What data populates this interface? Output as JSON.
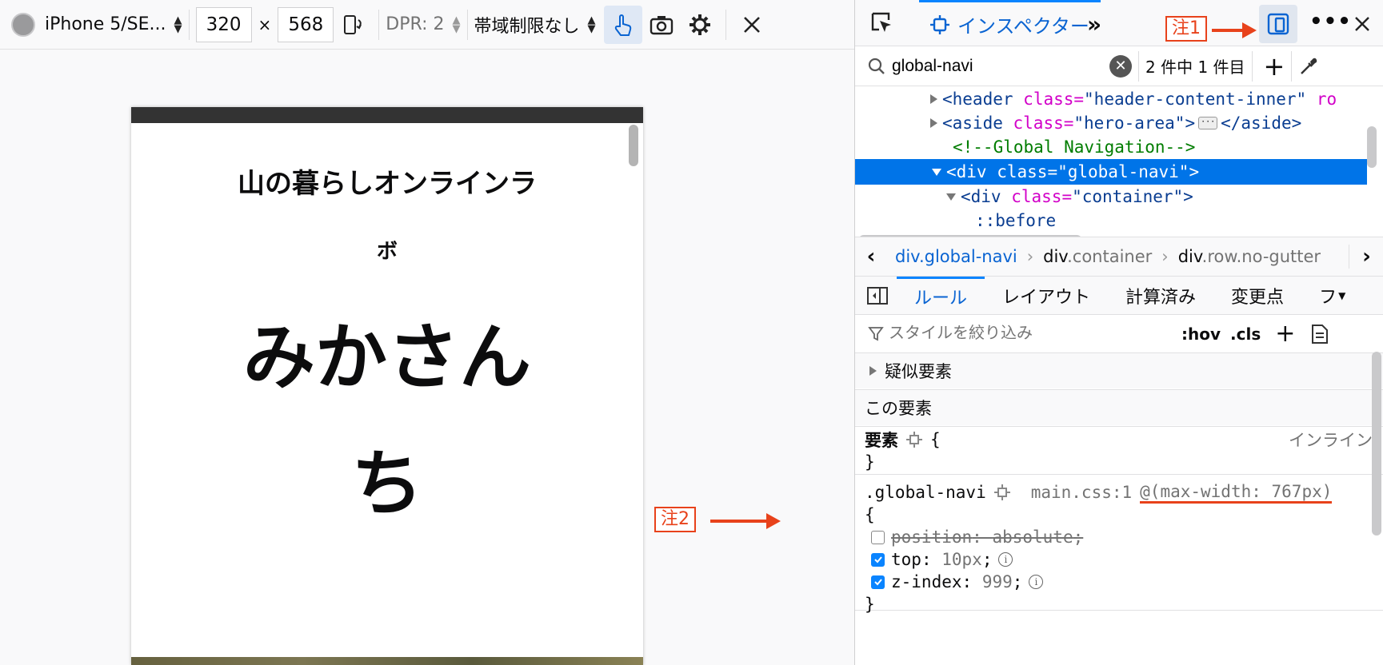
{
  "toolbar": {
    "device": "iPhone 5/SE...",
    "width": "320",
    "times": "×",
    "height": "568",
    "dpr": "DPR: 2",
    "throttle": "帯域制限なし"
  },
  "phone": {
    "line1": "山の暮らしオンラインラ",
    "line2": "ボ",
    "line3": "みかさん",
    "line4": "ち"
  },
  "devtools": {
    "inspector_tab": "インスペクター",
    "note1": "注1",
    "note2": "注2",
    "search_value": "global-navi",
    "search_count": "2 件中 1 件目",
    "markup": {
      "line1_tag": "<header",
      "line1_attr": "class=",
      "line1_val": "\"header-content-inner\"",
      "line1_extra": "ro",
      "line2_tag": "<aside",
      "line2_attr": "class=",
      "line2_val": "\"hero-area\"",
      "line2_end": "</aside>",
      "line3_comment": "<!--Global Navigation-->",
      "line4_tag": "<div",
      "line4_attr": "class=",
      "line4_val": "\"global-navi\"",
      "line5_tag": "<div",
      "line5_attr": "class=",
      "line5_val": "\"container\"",
      "line6_pseudo": "::before"
    },
    "breadcrumbs": [
      {
        "tag": "div",
        "cls": ".global-navi"
      },
      {
        "tag": "div",
        "cls": ".container"
      },
      {
        "tag": "div",
        "cls": ".row.no-gutter"
      }
    ],
    "side_tabs": [
      "ルール",
      "レイアウト",
      "計算済み",
      "変更点",
      "フ"
    ],
    "filter_placeholder": "スタイルを絞り込み",
    "hov": ":hov",
    "cls": ".cls",
    "pseudo_elements": "疑似要素",
    "this_element": "この要素",
    "element_rule": {
      "selector": "要素",
      "open": "{",
      "close": "}",
      "source": "インライン"
    },
    "rule": {
      "selector": ".global-navi",
      "source": "main.css:1",
      "media": "@(max-width: 767px)",
      "open": "{",
      "close": "}",
      "decls": [
        {
          "prop": "position",
          "value": "absolute",
          "enabled": false
        },
        {
          "prop": "top",
          "value": "10px",
          "enabled": true
        },
        {
          "prop": "z-index",
          "value": "999",
          "enabled": true
        }
      ]
    }
  },
  "colors": {
    "accent": "#0a84ff",
    "selection": "#0074e8",
    "annotation": "#e8421b"
  }
}
